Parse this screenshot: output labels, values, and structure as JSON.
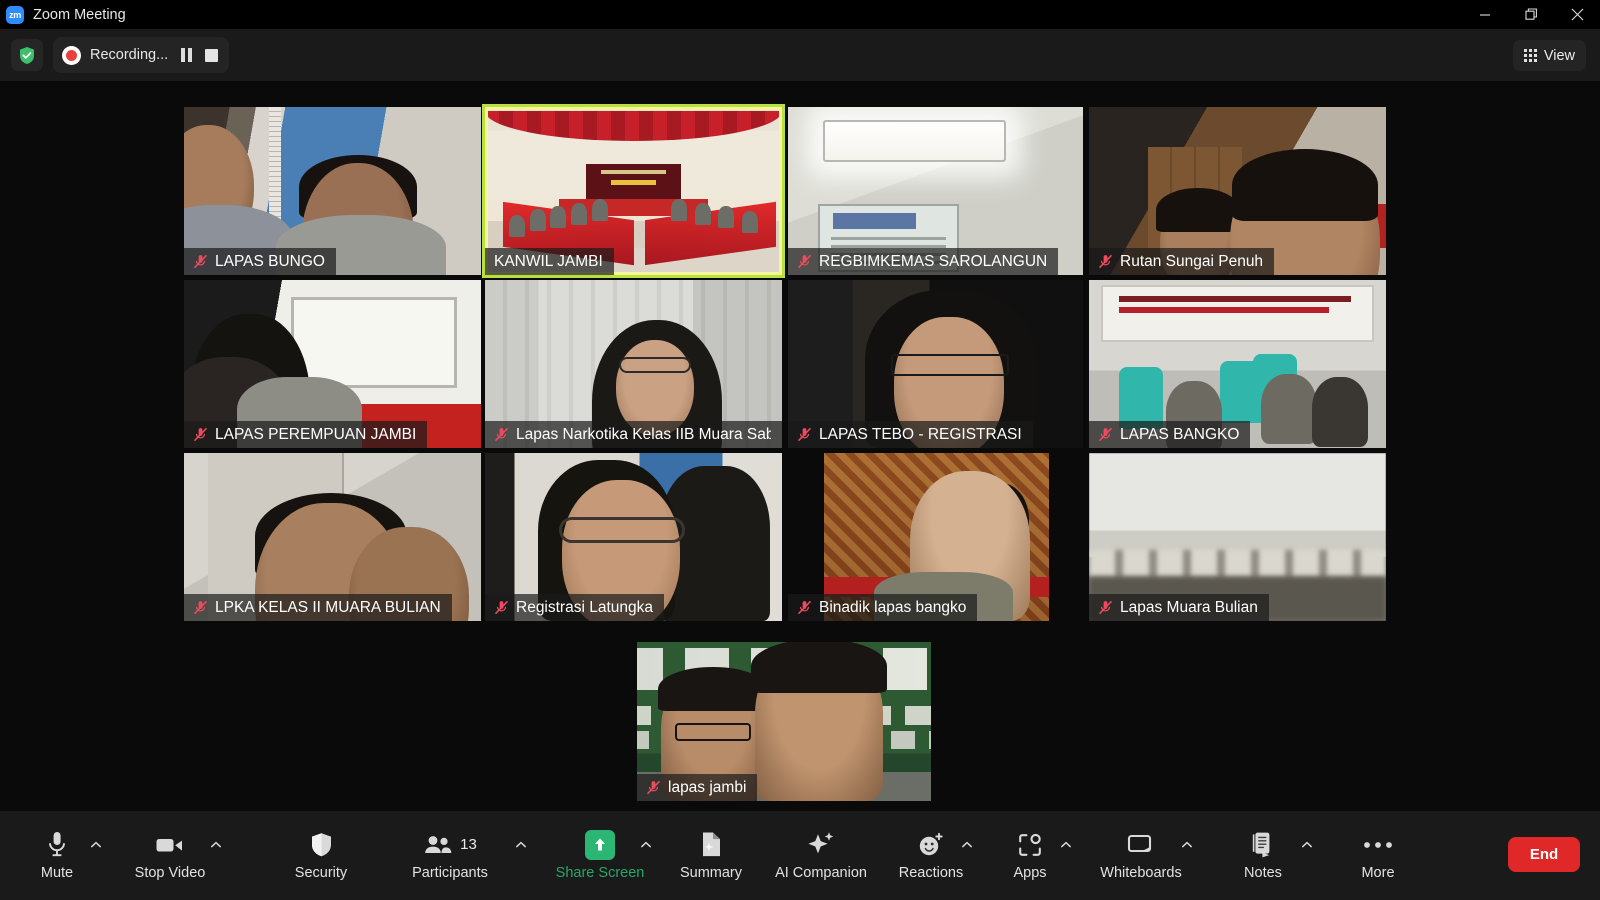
{
  "window": {
    "title": "Zoom Meeting",
    "logo_text": "zm",
    "minimize_label": "Minimize",
    "restore_label": "Restore",
    "close_label": "Close"
  },
  "topbar": {
    "shield_icon": "shield-check-icon",
    "recording_label": "Recording...",
    "pause_label": "Pause Recording",
    "stop_label": "Stop Recording",
    "view_label": "View",
    "view_icon": "grid-icon"
  },
  "gallery": {
    "tiles": [
      {
        "name": "LAPAS BUNGO",
        "muted": true,
        "active": false,
        "style": "v-bungo"
      },
      {
        "name": "KANWIL JAMBI",
        "muted": false,
        "active": true,
        "style": "v-kanwil"
      },
      {
        "name": "REGBIMKEMAS SAROLANGUN",
        "muted": true,
        "active": false,
        "style": "v-regbim"
      },
      {
        "name": "Rutan Sungai Penuh",
        "muted": true,
        "active": false,
        "style": "v-rutan"
      },
      {
        "name": "LAPAS PEREMPUAN JAMBI",
        "muted": true,
        "active": false,
        "style": "v-perempuan"
      },
      {
        "name": "Lapas Narkotika Kelas IIB Muara Sab...",
        "muted": true,
        "active": false,
        "style": "v-narkotika"
      },
      {
        "name": "LAPAS TEBO - REGISTRASI",
        "muted": true,
        "active": false,
        "style": "v-tebo"
      },
      {
        "name": "LAPAS BANGKO",
        "muted": true,
        "active": false,
        "style": "v-bangko"
      },
      {
        "name": "LPKA KELAS II MUARA BULIAN",
        "muted": true,
        "active": false,
        "style": "v-lpka"
      },
      {
        "name": "Registrasi Latungka",
        "muted": true,
        "active": false,
        "style": "v-latungka"
      },
      {
        "name": "Binadik lapas bangko",
        "muted": true,
        "active": false,
        "style": "v-binadik"
      },
      {
        "name": "Lapas Muara Bulian",
        "muted": true,
        "active": false,
        "style": "v-muarabulian"
      },
      {
        "name": "lapas jambi",
        "muted": true,
        "active": false,
        "style": "v-lapasjambi"
      }
    ]
  },
  "toolbar": {
    "mute_label": "Mute",
    "mute_icon": "microphone-icon",
    "stop_video_label": "Stop Video",
    "stop_video_icon": "camera-icon",
    "security_label": "Security",
    "security_icon": "shield-icon",
    "participants_label": "Participants",
    "participants_icon": "people-icon",
    "participants_count": "13",
    "share_screen_label": "Share Screen",
    "share_screen_icon": "upload-arrow-icon",
    "summary_label": "Summary",
    "summary_icon": "document-sparkle-icon",
    "ai_companion_label": "AI Companion",
    "ai_companion_icon": "sparkle-icon",
    "reactions_label": "Reactions",
    "reactions_icon": "smiley-plus-icon",
    "apps_label": "Apps",
    "apps_icon": "apps-icon",
    "whiteboards_label": "Whiteboards",
    "whiteboards_icon": "whiteboard-icon",
    "notes_label": "Notes",
    "notes_icon": "notes-icon",
    "more_label": "More",
    "more_icon": "ellipsis-icon",
    "end_label": "End"
  },
  "colors": {
    "accent_green": "#27a76a",
    "share_green": "#2bb673",
    "end_red": "#e02828",
    "active_speaker": "#b8e040",
    "toolbar_bg": "#1a1a1a"
  }
}
